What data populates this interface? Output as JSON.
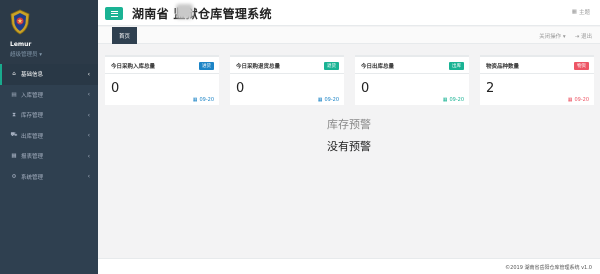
{
  "app": {
    "title": "湖南省  监狱仓库管理系统",
    "theme_label": "主题"
  },
  "user": {
    "name": "Lemur",
    "role": "超级管理员 ▾"
  },
  "sidebar": {
    "items": [
      {
        "label": "基础信息",
        "icon": "home-icon",
        "glyph": "⌂"
      },
      {
        "label": "入库管理",
        "icon": "inbox-icon",
        "glyph": "▤"
      },
      {
        "label": "库存管理",
        "icon": "hourglass-icon",
        "glyph": "⧗"
      },
      {
        "label": "出库管理",
        "icon": "truck-icon",
        "glyph": "⛟"
      },
      {
        "label": "报表管理",
        "icon": "report-icon",
        "glyph": "▦"
      },
      {
        "label": "系统管理",
        "icon": "gear-icon",
        "glyph": "⚙"
      }
    ]
  },
  "tabs": {
    "home": "首页",
    "close_ops": "关闭操作 ▾",
    "logout": "退出"
  },
  "cards": [
    {
      "title": "今日采购入库总量",
      "badge": "进货",
      "badge_color": "#1c84c6",
      "value": "0",
      "date": "09-20",
      "date_color": "#1c84c6"
    },
    {
      "title": "今日采购退货总量",
      "badge": "退货",
      "badge_color": "#1ab394",
      "value": "0",
      "date": "09-20",
      "date_color": "#1c84c6"
    },
    {
      "title": "今日出库总量",
      "badge": "出库",
      "badge_color": "#1ab394",
      "value": "0",
      "date": "09-20",
      "date_color": "#1ab394"
    },
    {
      "title": "物资品种数量",
      "badge": "物资",
      "badge_color": "#ed5565",
      "value": "2",
      "date": "09-20",
      "date_color": "#ed5565"
    }
  ],
  "warning": {
    "title": "库存预警",
    "empty": "没有预警"
  },
  "footer": {
    "copyright": "©2019 湖南省岳阳仓库管理系统 v1.0"
  },
  "colors": {
    "accent": "#1ab394",
    "sidebar": "#2f4050"
  }
}
